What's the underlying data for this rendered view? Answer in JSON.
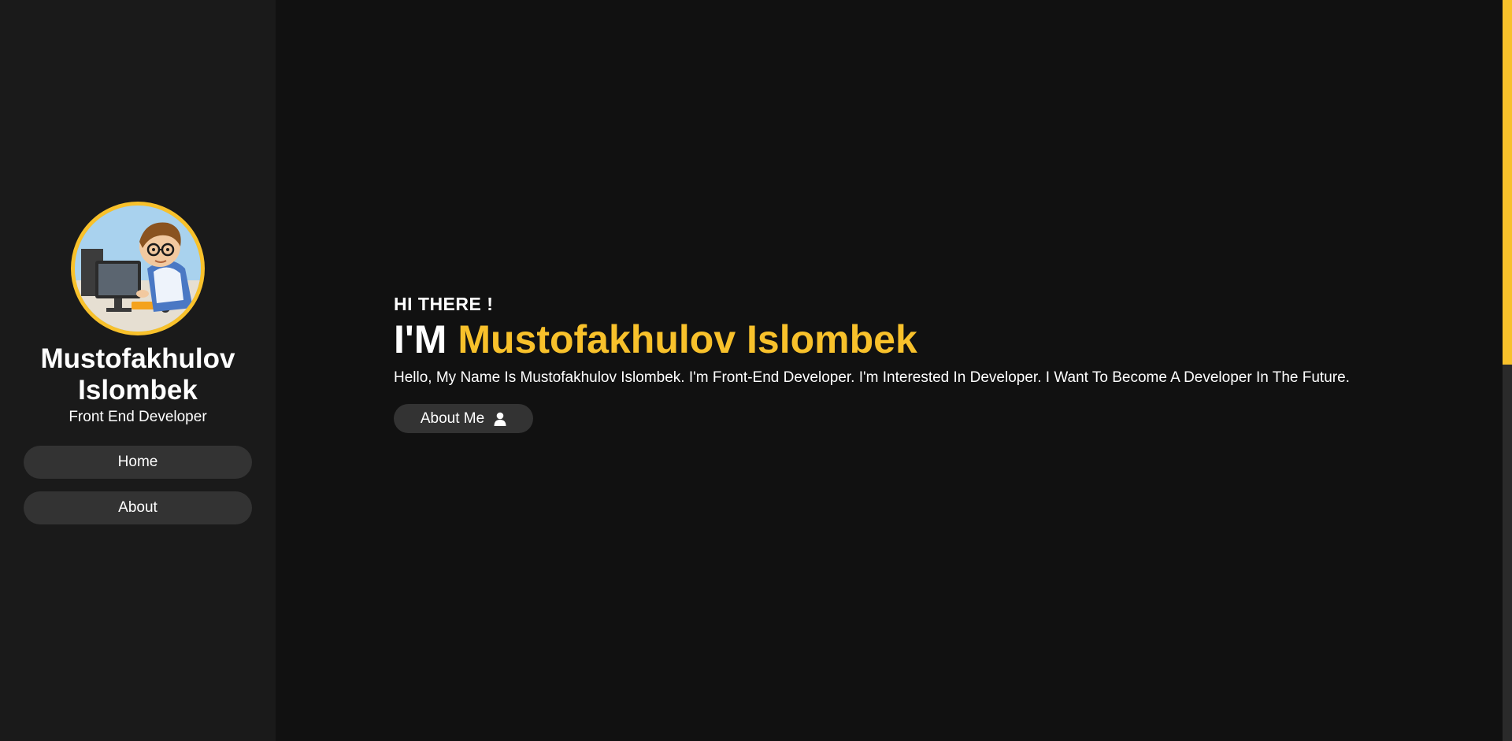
{
  "sidebar": {
    "profile_name": "Mustofakhulov Islombek",
    "profile_role": "Front End Developer",
    "nav": [
      {
        "label": "Home"
      },
      {
        "label": "About"
      }
    ]
  },
  "hero": {
    "greeting": "HI THERE !",
    "headline_prefix": "I'M",
    "headline_name": "Mustofakhulov Islombek",
    "intro": "Hello, My Name Is Mustofakhulov Islombek. I'm Front-End Developer. I'm Interested In Developer. I Want To Become A Developer In The Future.",
    "button_label": "About Me",
    "button_icon": "user-icon"
  },
  "colors": {
    "accent": "#f8c12b",
    "background": "#111111",
    "sidebar": "#1a1a1a",
    "button": "#333333"
  }
}
